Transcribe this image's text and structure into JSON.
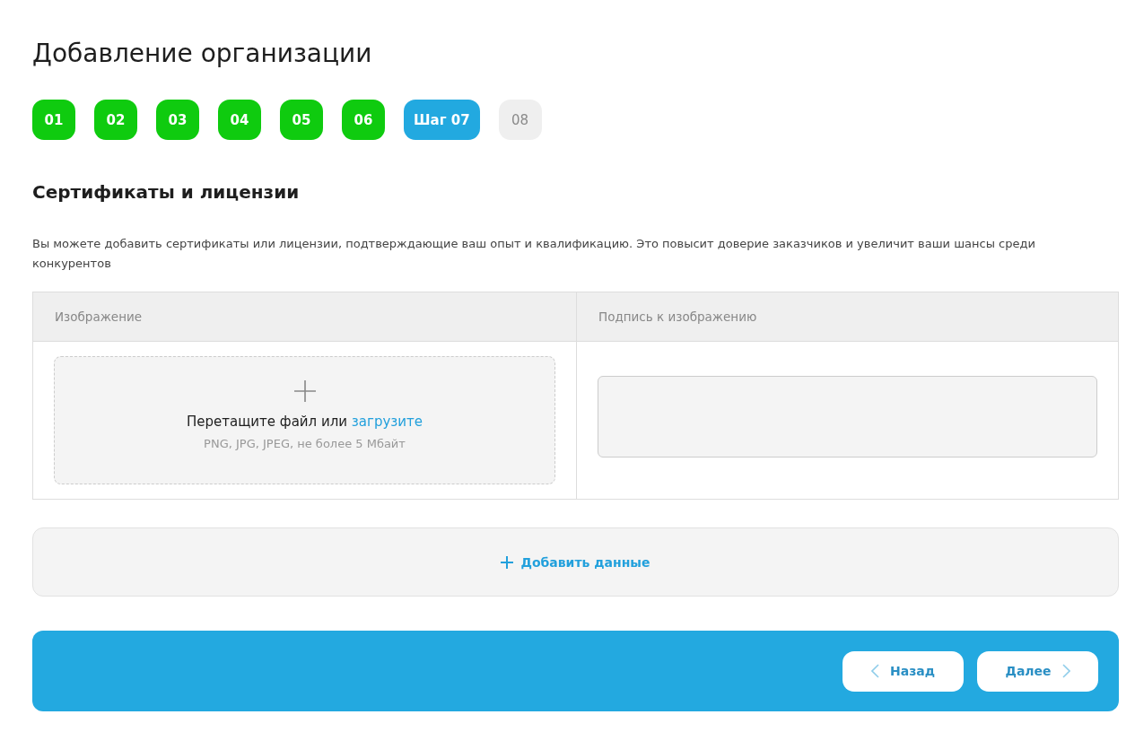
{
  "title": "Добавление организации",
  "steps": [
    {
      "label": "01",
      "kind": "done"
    },
    {
      "label": "02",
      "kind": "done"
    },
    {
      "label": "03",
      "kind": "done"
    },
    {
      "label": "04",
      "kind": "done"
    },
    {
      "label": "05",
      "kind": "done"
    },
    {
      "label": "06",
      "kind": "done"
    },
    {
      "label": "Шаг 07",
      "kind": "current"
    },
    {
      "label": "08",
      "kind": "todo"
    }
  ],
  "section": {
    "heading": "Сертификаты и лицензии",
    "description": "Вы можете добавить сертификаты или лицензии, подтверждающие ваш опыт и квалификацию. Это повысит доверие заказчиков и увеличит ваши шансы среди конкурентов"
  },
  "table": {
    "columns": [
      "Изображение",
      "Подпись к изображению"
    ],
    "upload": {
      "prompt": "Перетащите файл или",
      "link": "загрузите",
      "hint": "PNG, JPG, JPEG, не более 5 Мбайт"
    }
  },
  "add_button": "Добавить данные",
  "footer": {
    "back": "Назад",
    "next": "Далее"
  }
}
